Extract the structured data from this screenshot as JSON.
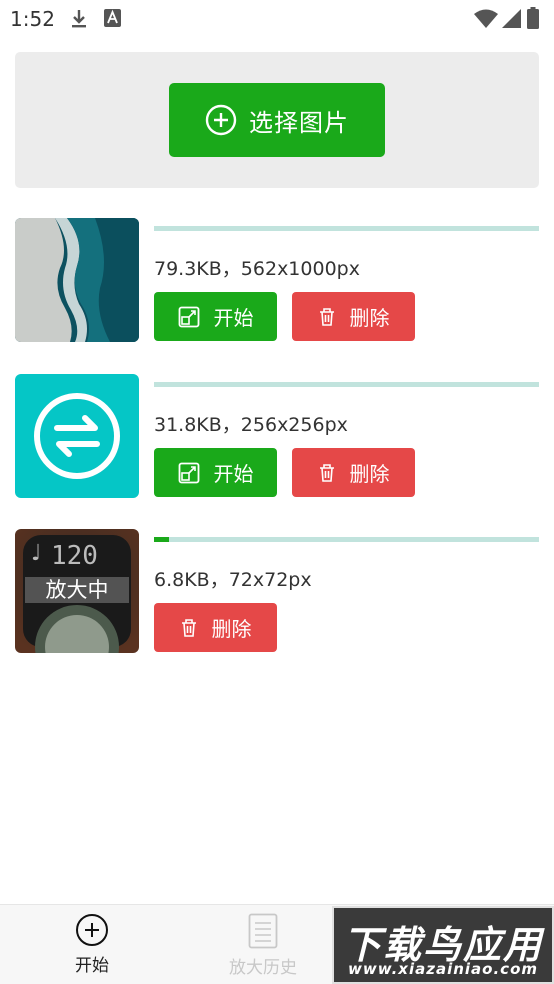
{
  "status_bar": {
    "time": "1:52",
    "icons": [
      "download-icon",
      "a-icon",
      "wifi-icon",
      "signal-icon",
      "battery-icon"
    ]
  },
  "picker": {
    "select_label": "选择图片",
    "icon": "plus-circle-icon"
  },
  "images": [
    {
      "info": "79.3KB，562x1000px",
      "progress": 0,
      "start_label": "开始",
      "delete_label": "删除",
      "thumb": "ocean-beach"
    },
    {
      "info": "31.8KB，256x256px",
      "progress": 0,
      "start_label": "开始",
      "delete_label": "删除",
      "thumb": "swap-arrows-icon"
    },
    {
      "info": "6.8KB，72x72px",
      "progress": 0.04,
      "status": "放大中",
      "delete_label": "删除",
      "thumb": "metronome-app",
      "thumb_text": [
        "♩",
        "120"
      ]
    }
  ],
  "bottom_nav": {
    "start_label": "开始",
    "history_label": "放大历史"
  },
  "watermark": {
    "main": "下载鸟应用",
    "sub": "www.xiazainiao.com"
  },
  "colors": {
    "green": "#1aa91a",
    "red": "#e54848",
    "track": "#c1e3dd",
    "panel": "#ececec"
  }
}
